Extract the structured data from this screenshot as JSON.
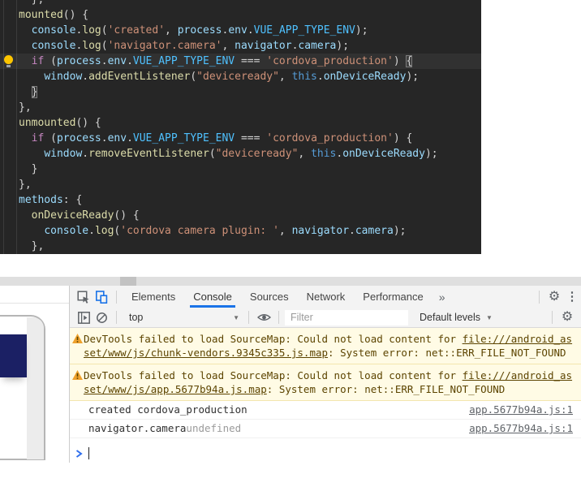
{
  "colors": {
    "editor_bg": "#262626",
    "accent": "#1a73e8",
    "warn_bg": "#fffbe5",
    "warn_text": "#5c4400",
    "tok_pun": "#d4d4d4",
    "tok_fn": "#dcdcaa",
    "tok_prop": "#9cdcfe",
    "tok_const": "#4fc1ff",
    "tok_str": "#ce9178",
    "tok_kw": "#c586c0",
    "tok_this": "#569cd6",
    "device_screen": "#1b2064"
  },
  "editor": {
    "current_line": 4,
    "lightbulb_line": 4,
    "lines": [
      [
        {
          "t": "  },",
          "c": "pun"
        }
      ],
      [
        {
          "t": "mounted",
          "c": "fn"
        },
        {
          "t": "() {",
          "c": "pun"
        }
      ],
      [
        {
          "t": "  ",
          "c": "pun"
        },
        {
          "t": "console",
          "c": "prop"
        },
        {
          "t": ".",
          "c": "pun"
        },
        {
          "t": "log",
          "c": "fn"
        },
        {
          "t": "(",
          "c": "pun"
        },
        {
          "t": "'created'",
          "c": "str"
        },
        {
          "t": ", ",
          "c": "pun"
        },
        {
          "t": "process",
          "c": "prop"
        },
        {
          "t": ".",
          "c": "pun"
        },
        {
          "t": "env",
          "c": "prop"
        },
        {
          "t": ".",
          "c": "pun"
        },
        {
          "t": "VUE_APP_TYPE_ENV",
          "c": "const"
        },
        {
          "t": ");",
          "c": "pun"
        }
      ],
      [
        {
          "t": "  ",
          "c": "pun"
        },
        {
          "t": "console",
          "c": "prop"
        },
        {
          "t": ".",
          "c": "pun"
        },
        {
          "t": "log",
          "c": "fn"
        },
        {
          "t": "(",
          "c": "pun"
        },
        {
          "t": "'navigator.camera'",
          "c": "str"
        },
        {
          "t": ", ",
          "c": "pun"
        },
        {
          "t": "navigator",
          "c": "prop"
        },
        {
          "t": ".",
          "c": "pun"
        },
        {
          "t": "camera",
          "c": "prop"
        },
        {
          "t": ");",
          "c": "pun"
        }
      ],
      [
        {
          "t": "  ",
          "c": "pun"
        },
        {
          "t": "if",
          "c": "kw"
        },
        {
          "t": " (",
          "c": "pun"
        },
        {
          "t": "process",
          "c": "prop"
        },
        {
          "t": ".",
          "c": "pun"
        },
        {
          "t": "env",
          "c": "prop"
        },
        {
          "t": ".",
          "c": "pun"
        },
        {
          "t": "VUE_APP_TYPE_ENV",
          "c": "const"
        },
        {
          "t": " === ",
          "c": "pun"
        },
        {
          "t": "'cordova_production'",
          "c": "str"
        },
        {
          "t": ") ",
          "c": "pun"
        },
        {
          "t": "{",
          "c": "pun",
          "boxed": true
        }
      ],
      [
        {
          "t": "    ",
          "c": "pun"
        },
        {
          "t": "window",
          "c": "prop"
        },
        {
          "t": ".",
          "c": "pun"
        },
        {
          "t": "addEventListener",
          "c": "fn"
        },
        {
          "t": "(",
          "c": "pun"
        },
        {
          "t": "\"deviceready\"",
          "c": "str"
        },
        {
          "t": ", ",
          "c": "pun"
        },
        {
          "t": "this",
          "c": "this"
        },
        {
          "t": ".",
          "c": "pun"
        },
        {
          "t": "onDeviceReady",
          "c": "prop"
        },
        {
          "t": ");",
          "c": "pun"
        }
      ],
      [
        {
          "t": "  ",
          "c": "pun"
        },
        {
          "t": "}",
          "c": "pun",
          "boxed": true
        }
      ],
      [
        {
          "t": "},",
          "c": "pun"
        }
      ],
      [
        {
          "t": "unmounted",
          "c": "fn"
        },
        {
          "t": "() {",
          "c": "pun"
        }
      ],
      [
        {
          "t": "  ",
          "c": "pun"
        },
        {
          "t": "if",
          "c": "kw"
        },
        {
          "t": " (",
          "c": "pun"
        },
        {
          "t": "process",
          "c": "prop"
        },
        {
          "t": ".",
          "c": "pun"
        },
        {
          "t": "env",
          "c": "prop"
        },
        {
          "t": ".",
          "c": "pun"
        },
        {
          "t": "VUE_APP_TYPE_ENV",
          "c": "const"
        },
        {
          "t": " === ",
          "c": "pun"
        },
        {
          "t": "'cordova_production'",
          "c": "str"
        },
        {
          "t": ") {",
          "c": "pun"
        }
      ],
      [
        {
          "t": "    ",
          "c": "pun"
        },
        {
          "t": "window",
          "c": "prop"
        },
        {
          "t": ".",
          "c": "pun"
        },
        {
          "t": "removeEventListener",
          "c": "fn"
        },
        {
          "t": "(",
          "c": "pun"
        },
        {
          "t": "\"deviceready\"",
          "c": "str"
        },
        {
          "t": ", ",
          "c": "pun"
        },
        {
          "t": "this",
          "c": "this"
        },
        {
          "t": ".",
          "c": "pun"
        },
        {
          "t": "onDeviceReady",
          "c": "prop"
        },
        {
          "t": ");",
          "c": "pun"
        }
      ],
      [
        {
          "t": "  }",
          "c": "pun"
        }
      ],
      [
        {
          "t": "},",
          "c": "pun"
        }
      ],
      [
        {
          "t": "methods",
          "c": "prop"
        },
        {
          "t": ": {",
          "c": "pun"
        }
      ],
      [
        {
          "t": "  ",
          "c": "pun"
        },
        {
          "t": "onDeviceReady",
          "c": "fn"
        },
        {
          "t": "() {",
          "c": "pun"
        }
      ],
      [
        {
          "t": "    ",
          "c": "pun"
        },
        {
          "t": "console",
          "c": "prop"
        },
        {
          "t": ".",
          "c": "pun"
        },
        {
          "t": "log",
          "c": "fn"
        },
        {
          "t": "(",
          "c": "pun"
        },
        {
          "t": "'cordova camera plugin: '",
          "c": "str"
        },
        {
          "t": ", ",
          "c": "pun"
        },
        {
          "t": "navigator",
          "c": "prop"
        },
        {
          "t": ".",
          "c": "pun"
        },
        {
          "t": "camera",
          "c": "prop"
        },
        {
          "t": ");",
          "c": "pun"
        }
      ],
      [
        {
          "t": "  },",
          "c": "pun"
        }
      ]
    ]
  },
  "devtools": {
    "tabs": {
      "items": [
        "Elements",
        "Console",
        "Sources",
        "Network",
        "Performance"
      ],
      "active": "Console"
    },
    "toolbar": {
      "context_label": "top",
      "filter_placeholder": "Filter",
      "levels_label": "Default levels"
    },
    "console": {
      "warnings": [
        {
          "text_before": "DevTools failed to load SourceMap: Could not load content for ",
          "link": "file:///android_asset/www/js/chunk-vendors.9345c335.js.map",
          "text_after": ": System error: net::ERR_FILE_NOT_FOUND"
        },
        {
          "text_before": "DevTools failed to load SourceMap: Could not load content for ",
          "link": "file:///android_asset/www/js/app.5677b94a.js.map",
          "text_after": ": System error: net::ERR_FILE_NOT_FOUND"
        }
      ],
      "logs": [
        {
          "parts": [
            {
              "t": "created cordova_production"
            }
          ],
          "source": "app.5677b94a.js:1"
        },
        {
          "parts": [
            {
              "t": "navigator.camera "
            },
            {
              "t": "undefined",
              "muted": true
            }
          ],
          "source": "app.5677b94a.js:1"
        }
      ]
    }
  },
  "icons": {
    "inspect": "inspect-cursor",
    "device_toolbar": "device-phone-tablet",
    "more_tabs": "»",
    "settings_gear": "⚙",
    "menu_dots": "⋮",
    "sidebar_toggle": "panel-right-triangle",
    "clear_console": "circle-slash",
    "eye": "live-expression-eye",
    "dropdown_arrow": "▼",
    "warning": "⚠",
    "prompt_chevron": ">",
    "lightbulb": "quick-fix-bulb"
  }
}
